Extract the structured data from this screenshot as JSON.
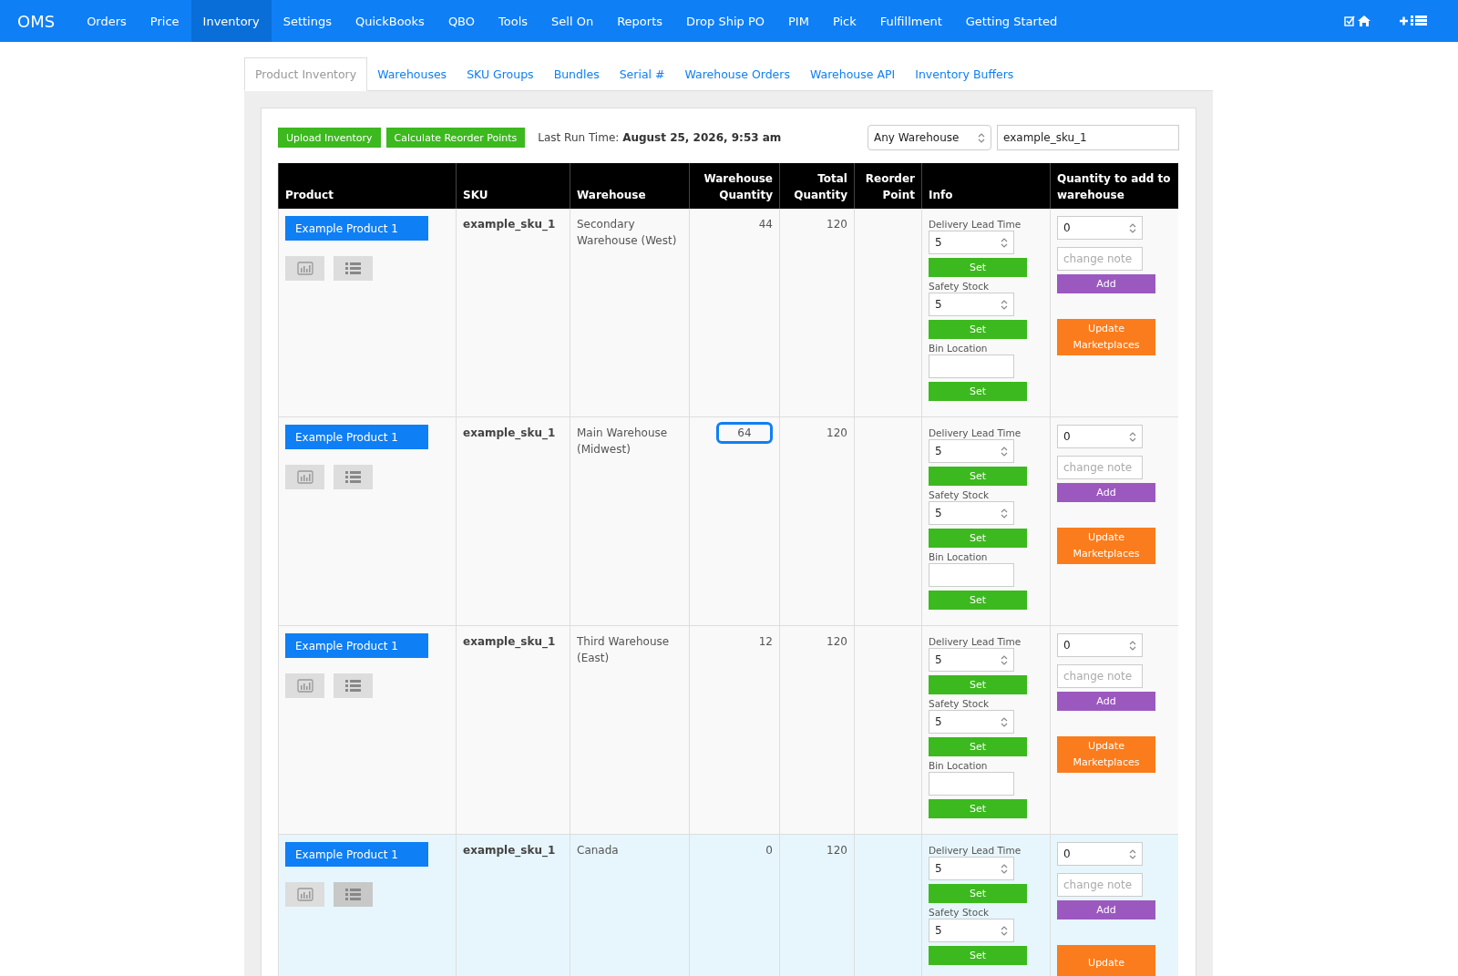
{
  "navbar": {
    "brand": "OMS",
    "items": [
      {
        "label": "Orders",
        "selected": false
      },
      {
        "label": "Price",
        "selected": false
      },
      {
        "label": "Inventory",
        "selected": true
      },
      {
        "label": "Settings",
        "selected": false
      },
      {
        "label": "QuickBooks",
        "selected": false
      },
      {
        "label": "QBO",
        "selected": false
      },
      {
        "label": "Tools",
        "selected": false
      },
      {
        "label": "Sell On",
        "selected": false
      },
      {
        "label": "Reports",
        "selected": false
      },
      {
        "label": "Drop Ship PO",
        "selected": false
      },
      {
        "label": "PIM",
        "selected": false
      },
      {
        "label": "Pick",
        "selected": false
      },
      {
        "label": "Fulfillment",
        "selected": false
      },
      {
        "label": "Getting Started",
        "selected": false
      }
    ]
  },
  "tabs": [
    {
      "label": "Product Inventory",
      "selected": true
    },
    {
      "label": "Warehouses",
      "selected": false
    },
    {
      "label": "SKU Groups",
      "selected": false
    },
    {
      "label": "Bundles",
      "selected": false
    },
    {
      "label": "Serial #",
      "selected": false
    },
    {
      "label": "Warehouse Orders",
      "selected": false
    },
    {
      "label": "Warehouse API",
      "selected": false
    },
    {
      "label": "Inventory Buffers",
      "selected": false
    }
  ],
  "toolbar": {
    "buttons": [
      "Upload Inventory",
      "Calculate Reorder Points"
    ],
    "last_run_label": "Last Run Time:",
    "last_run_value": "August 25, 2026, 9:53 am",
    "warehouse_select": "Any Warehouse",
    "sku_search": "example_sku_1"
  },
  "table": {
    "columns": [
      "Product",
      "SKU",
      "Warehouse",
      "Warehouse Quantity",
      "Total Quantity",
      "Reorder Point",
      "Info",
      "Quantity to add to warehouse"
    ],
    "rows": [
      {
        "product": "Example Product 1",
        "sku": "example_sku_1",
        "warehouse": "Secondary Warehouse (West)",
        "warehouse_quantity": "44",
        "quantity_focused": false,
        "total_quantity": "120",
        "selected": false,
        "info": [
          {
            "label": "Delivery Lead Time",
            "value": "5",
            "kind": "number",
            "button": "Set"
          },
          {
            "label": "Safety Stock",
            "value": "5",
            "kind": "number",
            "button": "Set"
          },
          {
            "label": "Bin Location",
            "kind": "text",
            "button": "Set"
          }
        ],
        "add_quantity": "0",
        "note_placeholder": "change note",
        "add_button": "Add",
        "update_button": "Update Marketplaces"
      },
      {
        "product": "Example Product 1",
        "sku": "example_sku_1",
        "warehouse": "Main Warehouse (Midwest)",
        "warehouse_quantity": "64",
        "quantity_focused": true,
        "total_quantity": "120",
        "selected": false,
        "info": [
          {
            "label": "Delivery Lead Time",
            "value": "5",
            "kind": "number",
            "button": "Set"
          },
          {
            "label": "Safety Stock",
            "value": "5",
            "kind": "number",
            "button": "Set"
          },
          {
            "label": "Bin Location",
            "kind": "text",
            "button": "Set"
          }
        ],
        "add_quantity": "0",
        "note_placeholder": "change note",
        "add_button": "Add",
        "update_button": "Update Marketplaces"
      },
      {
        "product": "Example Product 1",
        "sku": "example_sku_1",
        "warehouse": "Third Warehouse (East)",
        "warehouse_quantity": "12",
        "quantity_focused": false,
        "total_quantity": "120",
        "selected": false,
        "info": [
          {
            "label": "Delivery Lead Time",
            "value": "5",
            "kind": "number",
            "button": "Set"
          },
          {
            "label": "Safety Stock",
            "value": "5",
            "kind": "number",
            "button": "Set"
          },
          {
            "label": "Bin Location",
            "kind": "text",
            "button": "Set"
          }
        ],
        "add_quantity": "0",
        "note_placeholder": "change note",
        "add_button": "Add",
        "update_button": "Update Marketplaces"
      },
      {
        "product": "Example Product 1",
        "sku": "example_sku_1",
        "warehouse": "Canada",
        "warehouse_quantity": "0",
        "quantity_focused": false,
        "total_quantity": "120",
        "selected": true,
        "info": [
          {
            "label": "Delivery Lead Time",
            "value": "5",
            "kind": "number",
            "button": "Set"
          },
          {
            "label": "Safety Stock",
            "value": "5",
            "kind": "number",
            "button": "Set"
          }
        ],
        "add_quantity": "0",
        "note_placeholder": "change note",
        "add_button": "Add",
        "update_button": "Update"
      }
    ]
  }
}
